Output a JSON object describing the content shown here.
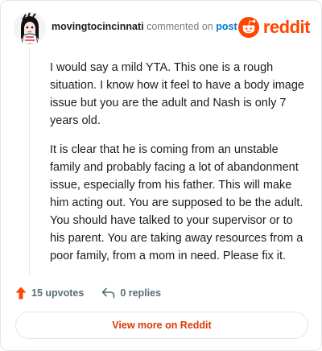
{
  "comment": {
    "username": "movingtocincinnati",
    "commented_on_text": "commented on",
    "post_link_text": "post",
    "paragraphs": [
      "I would say a mild YTA. This one is a rough situation. I know how it feel to have a body image issue but you are the adult and Nash is only 7 years old.",
      "It is clear that he is coming from an unstable family and probably facing a lot of abandonment issue, especially from his father. This will make him acting out. You are supposed to be the adult. You should have talked to your supervisor or to his parent. You are taking away resources from a poor family, from a mom in need. Please fix it."
    ]
  },
  "brand": {
    "name": "reddit",
    "logo_icon": "reddit-snoo-icon",
    "color": "#ff4500"
  },
  "actions": {
    "upvotes_label": "15 upvotes",
    "upvote_icon": "upvote-arrow-icon",
    "upvote_color": "#ff4500",
    "replies_label": "0 replies",
    "reply_icon": "reply-arrow-icon"
  },
  "footer": {
    "view_more_label": "View more on Reddit",
    "link_color": "#d93a00"
  }
}
